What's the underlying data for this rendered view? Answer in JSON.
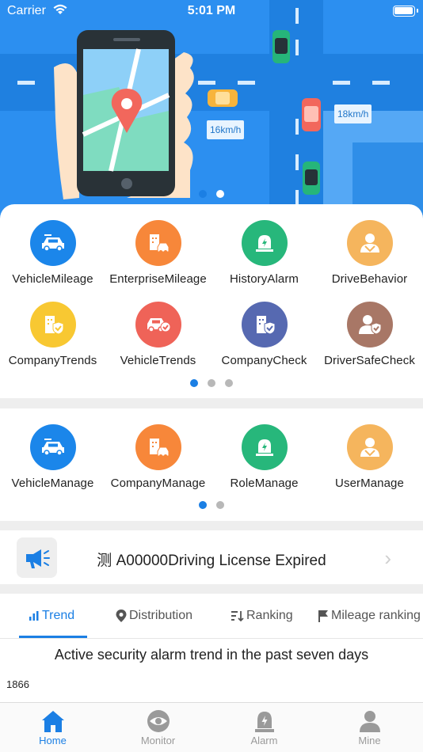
{
  "status_bar": {
    "carrier": "Carrier",
    "time": "5:01 PM"
  },
  "banner": {
    "speed_tags": [
      "16km/h",
      "18km/h"
    ],
    "page_count": 2,
    "active_page": 1
  },
  "quick_menu": {
    "items": [
      {
        "label": "VehicleMileage",
        "icon": "car-icon",
        "color": "#1b86ea"
      },
      {
        "label": "EnterpriseMileage",
        "icon": "building-car-icon",
        "color": "#f7873a"
      },
      {
        "label": "HistoryAlarm",
        "icon": "siren-icon",
        "color": "#27b77b"
      },
      {
        "label": "DriveBehavior",
        "icon": "driver-icon",
        "color": "#f5b55d"
      },
      {
        "label": "CompanyTrends",
        "icon": "building-check-icon",
        "color": "#f8c832"
      },
      {
        "label": "VehicleTrends",
        "icon": "car-check-icon",
        "color": "#ef6358"
      },
      {
        "label": "CompanyCheck",
        "icon": "building-shield-icon",
        "color": "#5669b1"
      },
      {
        "label": "DriverSafeCheck",
        "icon": "driver-shield-icon",
        "color": "#a87766"
      }
    ],
    "page_count": 3,
    "active_page": 1
  },
  "manage_menu": {
    "items": [
      {
        "label": "VehicleManage",
        "icon": "car-icon",
        "color": "#1b86ea"
      },
      {
        "label": "CompanyManage",
        "icon": "building-car-icon",
        "color": "#f7873a"
      },
      {
        "label": "RoleManage",
        "icon": "siren-icon",
        "color": "#27b77b"
      },
      {
        "label": "UserManage",
        "icon": "driver-icon",
        "color": "#f5b55d"
      }
    ],
    "page_count": 2,
    "active_page": 1
  },
  "notice": {
    "text": "测 A00000Driving License Expired",
    "icon": "megaphone-icon"
  },
  "tabs": {
    "items": [
      {
        "label": "Trend",
        "icon": "bar-chart-icon"
      },
      {
        "label": "Distribution",
        "icon": "location-pin-icon"
      },
      {
        "label": "Ranking",
        "icon": "sort-icon"
      },
      {
        "label": "Mileage ranking",
        "icon": "flag-icon"
      }
    ],
    "active": "Trend"
  },
  "chart": {
    "title": "Active security alarm trend in the past seven days",
    "max_value": "1866"
  },
  "bottom_nav": {
    "items": [
      {
        "label": "Home",
        "icon": "home-icon"
      },
      {
        "label": "Monitor",
        "icon": "eye-icon"
      },
      {
        "label": "Alarm",
        "icon": "alarm-icon"
      },
      {
        "label": "Mine",
        "icon": "user-icon"
      }
    ],
    "active": "Home"
  },
  "colors": {
    "accent": "#1b7fe4",
    "inactive": "#9a9a9a",
    "hero_bg": "#2c8ff0"
  }
}
